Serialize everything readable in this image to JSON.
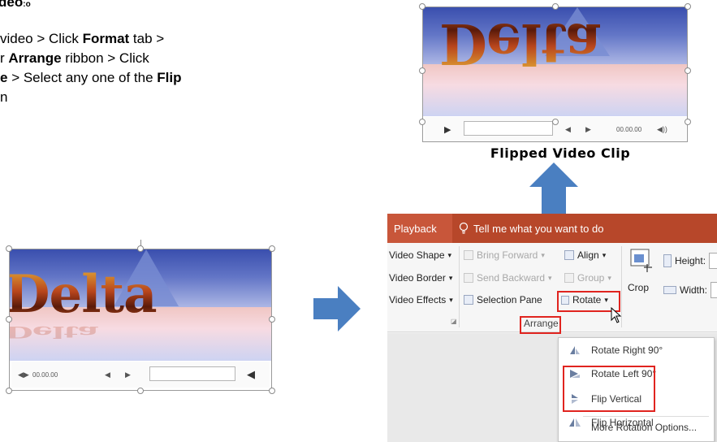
{
  "instructions": {
    "title": "deo",
    "title_sup": ":o",
    "line1_a": "video > Click ",
    "line1_b": "Format",
    "line1_c": " tab >",
    "line2_a": "r ",
    "line2_b": "Arrange",
    "line2_c": " ribbon > Click",
    "line3_a": "e",
    "line3_b": " > Select any one of the ",
    "line3_c": "Flip",
    "line4": "n"
  },
  "original_video": {
    "word": "Delta",
    "time": "00.00.00",
    "controls": [
      "play-pause",
      "rewind",
      "forward",
      "volume"
    ]
  },
  "flipped_video": {
    "word": "Delta",
    "time": "00.00.00",
    "caption": "Flipped Video Clip"
  },
  "ribbon": {
    "tab_playback": "Playback",
    "tell_me": "Tell me what you want to do",
    "video_shape": "Video Shape",
    "video_border": "Video Border",
    "video_effects": "Video Effects",
    "bring_forward": "Bring Forward",
    "send_backward": "Send Backward",
    "selection_pane": "Selection Pane",
    "align": "Align",
    "group": "Group",
    "rotate": "Rotate",
    "crop": "Crop",
    "height": "Height:",
    "width": "Width:",
    "arrange_group": "Arrange",
    "dropdown_caret": "▾"
  },
  "rotate_menu": {
    "items": [
      "Rotate Right 90°",
      "Rotate Left 90°",
      "Flip Vertical",
      "Flip Horizontal",
      "More Rotation Options..."
    ]
  },
  "colors": {
    "tab_bar": "#b7472a",
    "highlight_box": "#e0241f",
    "arrow_blue": "#4a7fc1"
  }
}
